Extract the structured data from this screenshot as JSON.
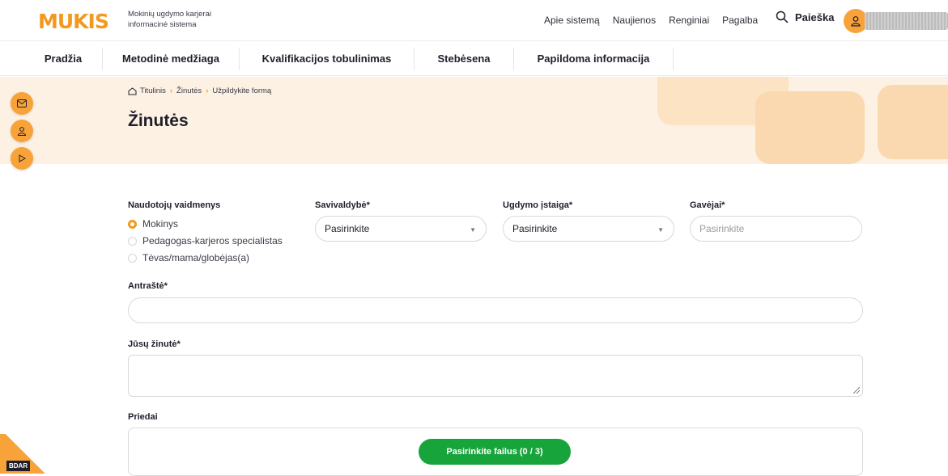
{
  "brand": {
    "logo_text": "MUKIS",
    "tagline": "Mokinių ugdymo karjerai informacinė sistema"
  },
  "topnav": [
    "Apie sistemą",
    "Naujienos",
    "Renginiai",
    "Pagalba"
  ],
  "search": {
    "label": "Paieška"
  },
  "mainnav": [
    "Pradžia",
    "Metodinė medžiaga",
    "Kvalifikacijos tobulinimas",
    "Stebėsena",
    "Papildoma informacija"
  ],
  "breadcrumb": [
    "Titulinis",
    "Žinutės",
    "Užpildykite formą"
  ],
  "page_title": "Žinutės",
  "form": {
    "roles": {
      "label": "Naudotojų vaidmenys",
      "options": [
        "Mokinys",
        "Pedagogas-karjeros specialistas",
        "Tėvas/mama/globėjas(a)"
      ],
      "selected": "Mokinys"
    },
    "municipality": {
      "label": "Savivaldybė*",
      "value": "Pasirinkite"
    },
    "school": {
      "label": "Ugdymo įstaiga*",
      "value": "Pasirinkite"
    },
    "recipients": {
      "label": "Gavėjai*",
      "placeholder": "Pasirinkite"
    },
    "subject": {
      "label": "Antraštė*"
    },
    "message": {
      "label": "Jūsų žinutė*"
    },
    "attachments": {
      "label": "Priedai",
      "button": "Pasirinkite failus (0 / 3)"
    }
  },
  "side_buttons": [
    "mail-icon",
    "user-icon",
    "play-icon"
  ],
  "footer_badge": "BDAR",
  "colors": {
    "accent": "#f39a1e",
    "hero_bg": "#fdf1e3",
    "upload_button": "#17a43b"
  }
}
